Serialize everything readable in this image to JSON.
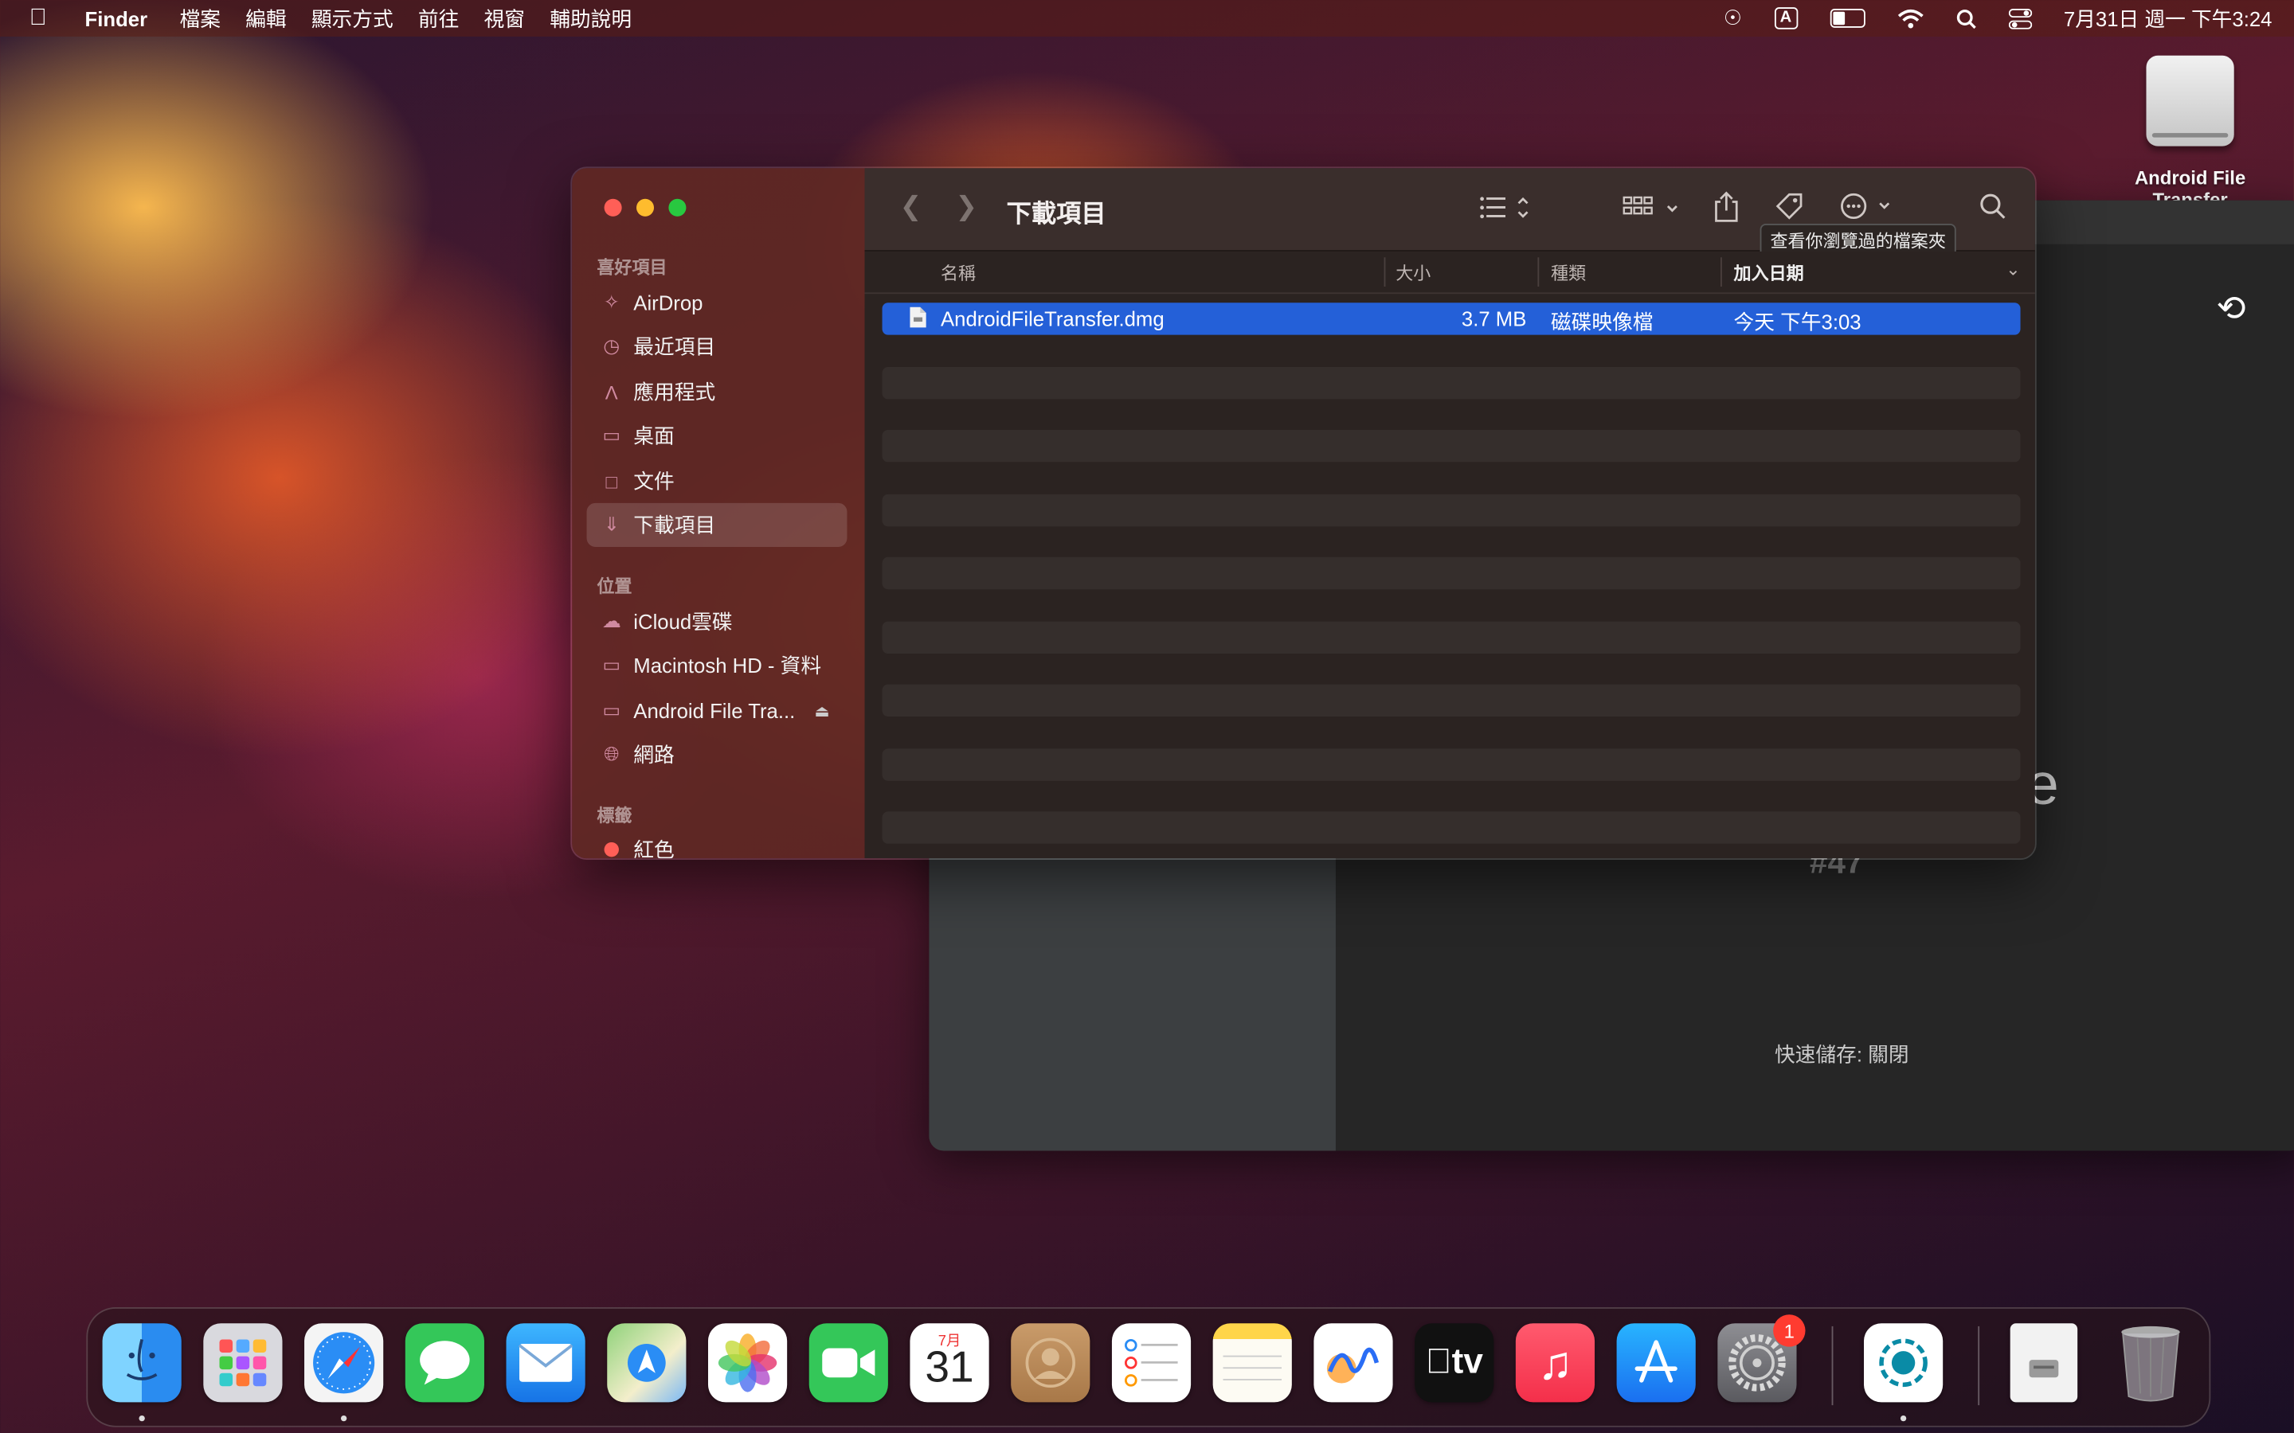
{
  "menubar": {
    "app": "Finder",
    "items": [
      "檔案",
      "編輯",
      "顯示方式",
      "前往",
      "視窗",
      "輔助說明"
    ],
    "clock": "7月31日 週一 下午3:24",
    "input_indicator": "A"
  },
  "desktop": {
    "drive_label": "Android File Transfer"
  },
  "finder": {
    "title": "下載項目",
    "tooltip": "查看你瀏覽過的檔案夾",
    "sidebar": {
      "favorites_header": "喜好項目",
      "favorites": [
        {
          "label": "AirDrop",
          "icon": "airdrop-icon"
        },
        {
          "label": "最近項目",
          "icon": "clock-icon"
        },
        {
          "label": "應用程式",
          "icon": "apps-icon"
        },
        {
          "label": "桌面",
          "icon": "desktop-icon"
        },
        {
          "label": "文件",
          "icon": "document-icon"
        },
        {
          "label": "下載項目",
          "icon": "download-icon",
          "selected": true
        }
      ],
      "locations_header": "位置",
      "locations": [
        {
          "label": "iCloud雲碟",
          "icon": "cloud-icon"
        },
        {
          "label": "Macintosh HD - 資料",
          "icon": "disk-icon"
        },
        {
          "label": "Android File Tra...",
          "icon": "disk-icon",
          "ejectable": true
        },
        {
          "label": "網路",
          "icon": "globe-icon"
        }
      ],
      "tags_header": "標籤",
      "tags": [
        {
          "label": "紅色",
          "color": "#ff5f57"
        }
      ]
    },
    "columns": {
      "name": "名稱",
      "size": "大小",
      "kind": "種類",
      "date_added": "加入日期"
    },
    "files": [
      {
        "name": "AndroidFileTransfer.dmg",
        "size": "3.7 MB",
        "kind": "磁碟映像檔",
        "date_added": "今天 下午3:03",
        "selected": true
      }
    ]
  },
  "background_window": {
    "hash": "#47",
    "quick_save": "快速儲存: 關閉",
    "partial_letter": "e"
  },
  "dock": {
    "apps": [
      "Finder",
      "Launchpad",
      "Safari",
      "Messages",
      "Mail",
      "Maps",
      "Photos",
      "FaceTime",
      "Calendar",
      "Contacts",
      "Reminders",
      "Notes",
      "Freeform",
      "TV",
      "Music",
      "App Store",
      "System Settings",
      "Screenshot",
      "Preview Document",
      "Trash"
    ],
    "calendar_month": "7月",
    "calendar_day": "31",
    "settings_badge": "1",
    "tv_label": "tv"
  }
}
